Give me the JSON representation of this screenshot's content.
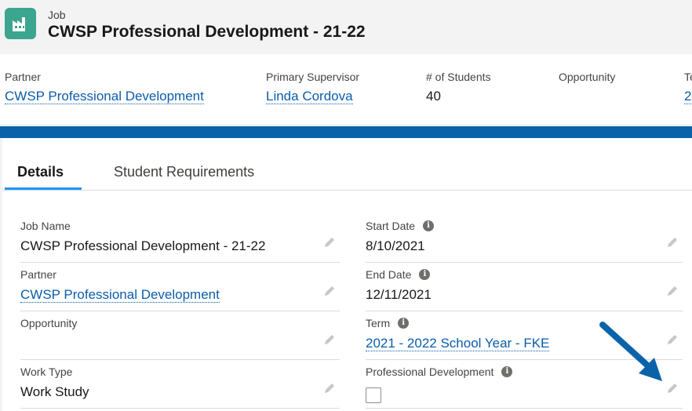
{
  "header": {
    "object_type": "Job",
    "title": "CWSP Professional Development - 21-22",
    "icon": "factory-icon",
    "icon_color": "#3ba58f"
  },
  "highlights": [
    {
      "label": "Partner",
      "value": "CWSP Professional Development",
      "is_link": true
    },
    {
      "label": "Primary Supervisor",
      "value": "Linda Cordova",
      "is_link": true
    },
    {
      "label": "# of Students",
      "value": "40",
      "is_link": false
    },
    {
      "label": "Opportunity",
      "value": "",
      "is_link": false
    },
    {
      "label": "Te",
      "value": "2",
      "is_link": true
    }
  ],
  "tabs": [
    {
      "label": "Details",
      "active": true
    },
    {
      "label": "Student Requirements",
      "active": false
    }
  ],
  "details": {
    "left": [
      {
        "label": "Job Name",
        "value": "CWSP Professional Development - 21-22",
        "is_link": false
      },
      {
        "label": "Partner",
        "value": "CWSP Professional Development",
        "is_link": true
      },
      {
        "label": "Opportunity",
        "value": "",
        "is_link": false
      },
      {
        "label": "Work Type",
        "value": "Work Study",
        "is_link": false
      }
    ],
    "right": [
      {
        "label": "Start Date",
        "value": "8/10/2021",
        "is_link": false,
        "info": true
      },
      {
        "label": "End Date",
        "value": "12/11/2021",
        "is_link": false,
        "info": true
      },
      {
        "label": "Term",
        "value": "2021 - 2022 School Year - FKE",
        "is_link": true,
        "info": true
      },
      {
        "label": "Professional Development",
        "value": "",
        "is_checkbox": true,
        "checked": false,
        "info": true
      }
    ]
  },
  "colors": {
    "link": "#0b5cab",
    "brand_bar": "#0a63a8",
    "active_tab": "#1b96ff",
    "annotation_arrow": "#0a63a8"
  }
}
